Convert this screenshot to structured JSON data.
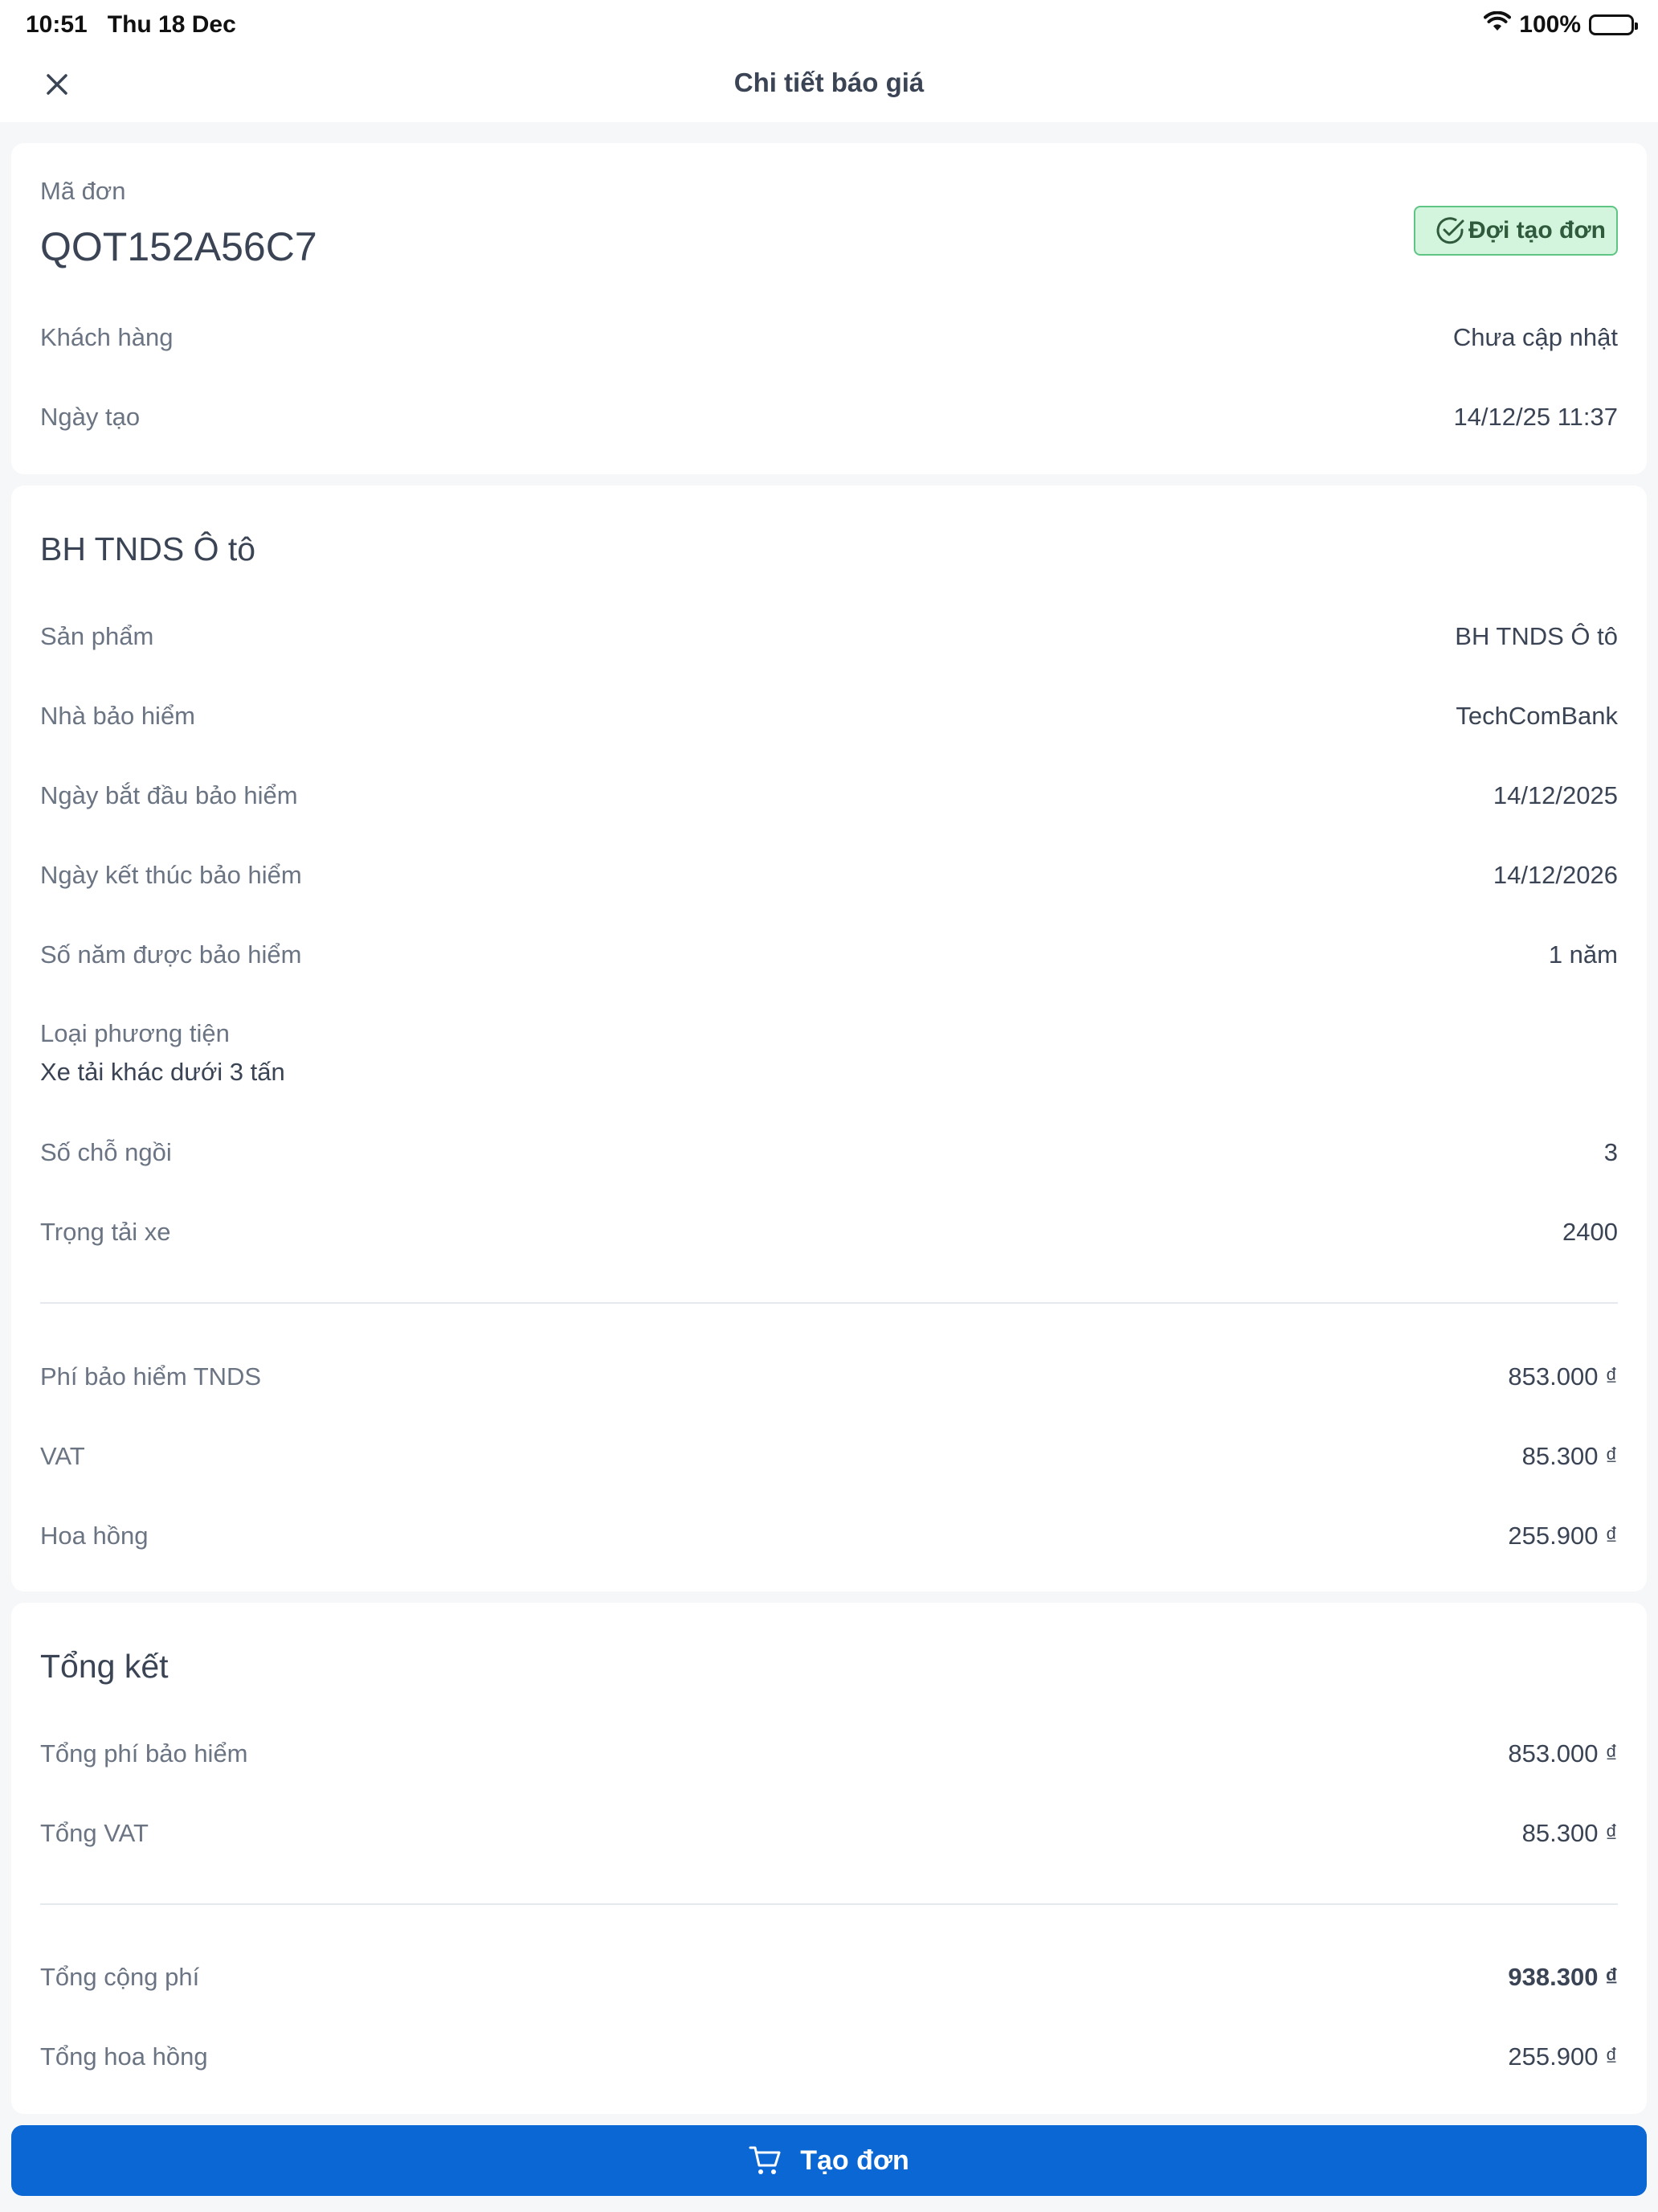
{
  "status_bar": {
    "time": "10:51",
    "date": "Thu 18 Dec",
    "battery_text": "100%"
  },
  "nav": {
    "title": "Chi tiết báo giá",
    "close_icon": "close-icon"
  },
  "order": {
    "code_label": "Mã đơn",
    "code": "QOT152A56C7",
    "status": "Đợi tạo đơn",
    "status_icon": "check-circle-icon",
    "customer_label": "Khách hàng",
    "customer_value": "Chưa cập nhật",
    "created_label": "Ngày tạo",
    "created_value": "14/12/25 11:37"
  },
  "product": {
    "title": "BH TNDS Ô tô",
    "rows": [
      {
        "label": "Sản phẩm",
        "value": "BH TNDS Ô tô"
      },
      {
        "label": "Nhà bảo hiểm",
        "value": "TechComBank"
      },
      {
        "label": "Ngày bắt đầu bảo hiểm",
        "value": "14/12/2025"
      },
      {
        "label": "Ngày kết thúc bảo hiểm",
        "value": "14/12/2026"
      },
      {
        "label": "Số năm được bảo hiểm",
        "value": "1 năm"
      }
    ],
    "vehicle_type_label": "Loại phương tiện",
    "vehicle_type_value": "Xe tải khác dưới 3 tấn",
    "rows2": [
      {
        "label": "Số chỗ ngồi",
        "value": "3"
      },
      {
        "label": "Trọng tải xe",
        "value": "2400"
      }
    ],
    "fees": [
      {
        "label": "Phí bảo hiểm TNDS",
        "value": "853.000 ₫"
      },
      {
        "label": "VAT",
        "value": "85.300 ₫"
      },
      {
        "label": "Hoa hồng",
        "value": "255.900 ₫"
      }
    ]
  },
  "summary": {
    "title": "Tổng kết",
    "rows": [
      {
        "label": "Tổng phí bảo hiểm",
        "value": "853.000 ₫"
      },
      {
        "label": "Tổng VAT",
        "value": "85.300 ₫"
      }
    ],
    "total_label": "Tổng cộng phí",
    "total_value": "938.300 ₫",
    "commission_label": "Tổng hoa hồng",
    "commission_value": "255.900 ₫"
  },
  "cta": {
    "label": "Tạo đơn",
    "icon": "cart-icon",
    "color": "#0a67d3"
  }
}
